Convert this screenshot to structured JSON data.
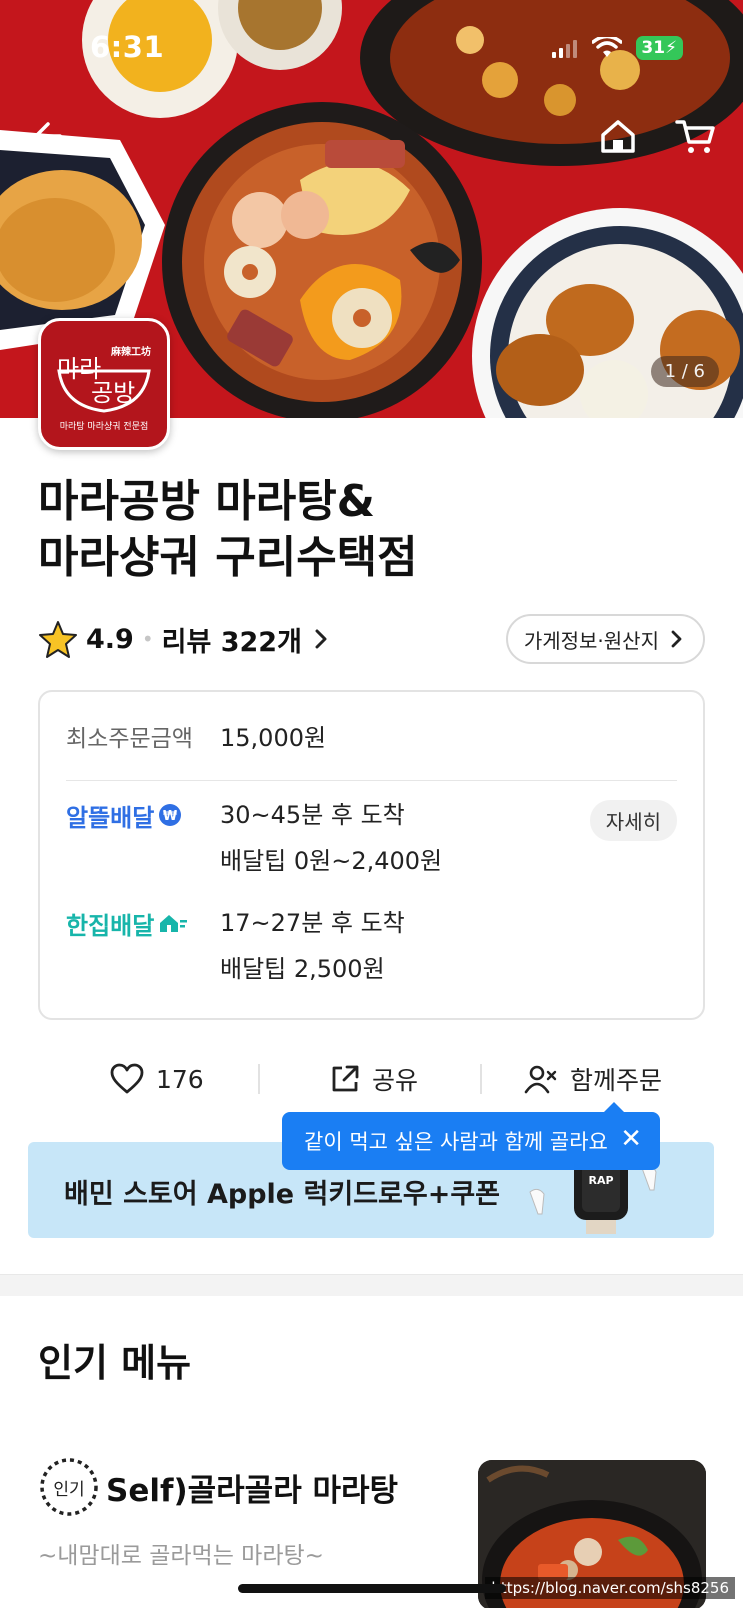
{
  "status_bar": {
    "time": "6:31",
    "battery": "31"
  },
  "hero": {
    "page_counter": "1 / 6"
  },
  "logo": {
    "name_top": "마라",
    "name_bottom": "공방",
    "hanzi": "麻辣工坊",
    "tagline": "마라탕 마라샹궈 전문점"
  },
  "store": {
    "title_line1": "마라공방 마라탕&",
    "title_line2": "마라샹궈 구리수택점",
    "rating": "4.9",
    "review_label": "리뷰 322개",
    "info_button": "가게정보·원산지"
  },
  "delivery_card": {
    "min_order_label": "최소주문금액",
    "min_order_value": "15,000원",
    "detail_button": "자세히",
    "options": [
      {
        "name": "알뜰배달",
        "time": "30~45분 후 도착",
        "tip": "배달팁 0원~2,400원",
        "color": "#2f6fe4"
      },
      {
        "name": "한집배달",
        "time": "17~27분 후 도착",
        "tip": "배달팁 2,500원",
        "color": "#17b5aa"
      }
    ]
  },
  "actions": {
    "like_count": "176",
    "share_label": "공유",
    "group_order_label": "함께주문"
  },
  "tooltip": {
    "text": "같이 먹고 싶은 사람과 함께 골라요"
  },
  "banner": {
    "text": "배민 스토어 Apple 럭키드로우+쿠폰"
  },
  "popular": {
    "section_title": "인기 메뉴",
    "badge": "인기",
    "item_name": "Self)골라골라 마라탕",
    "item_desc": "~내맘대로 골라먹는 마라탕~"
  },
  "watermark": "https://blog.naver.com/shs8256",
  "colors": {
    "accent_blue": "#1a7ef3",
    "brand_red": "#b3151c",
    "banner_bg": "#c7e6f8"
  },
  "icons": [
    "back-arrow-icon",
    "home-icon",
    "cart-icon",
    "star-icon",
    "chevron-right-icon",
    "heart-icon",
    "share-icon",
    "group-order-icon",
    "close-icon"
  ]
}
